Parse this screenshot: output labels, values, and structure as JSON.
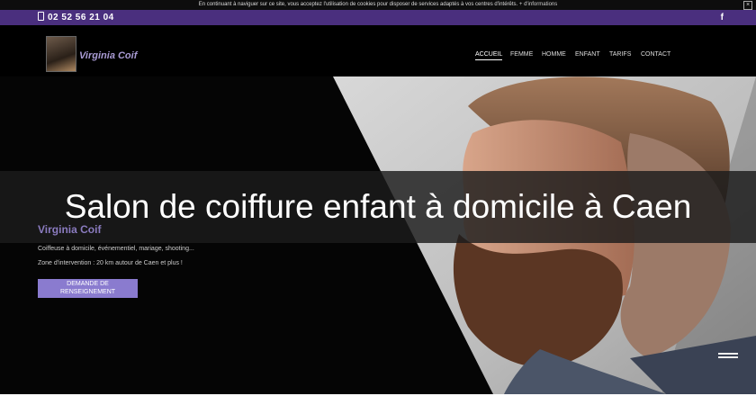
{
  "cookie_bar": {
    "text": "En continuant à naviguer sur ce site, vous acceptez l'utilisation de cookies pour disposer de services adaptés à vos centres d'intérêts.",
    "more_link": "+ d'informations",
    "close_label": "×"
  },
  "topbar": {
    "phone": "02 52 56 21 04",
    "social_icon": "facebook-icon",
    "social_label": "f"
  },
  "header": {
    "logo_text": "Virginia Coif",
    "nav": [
      "ACCUEIL",
      "FEMME",
      "HOMME",
      "ENFANT",
      "TARIFS",
      "CONTACT"
    ],
    "active_index": 0
  },
  "hero": {
    "title": "Salon de coiffure enfant à domicile à Caen",
    "brand": "Virginia Coif",
    "tagline": "Coiffeuse à domicile, événementiel, mariage, shooting...",
    "zone": "Zone d'intervention : 20 km autour de Caen et plus !",
    "cta_line1": "DEMANDE DE",
    "cta_line2": "RENSEIGNEMENT"
  },
  "colors": {
    "topbar": "#4a2f7e",
    "accent": "#8a7bcf",
    "header": "#000000"
  }
}
